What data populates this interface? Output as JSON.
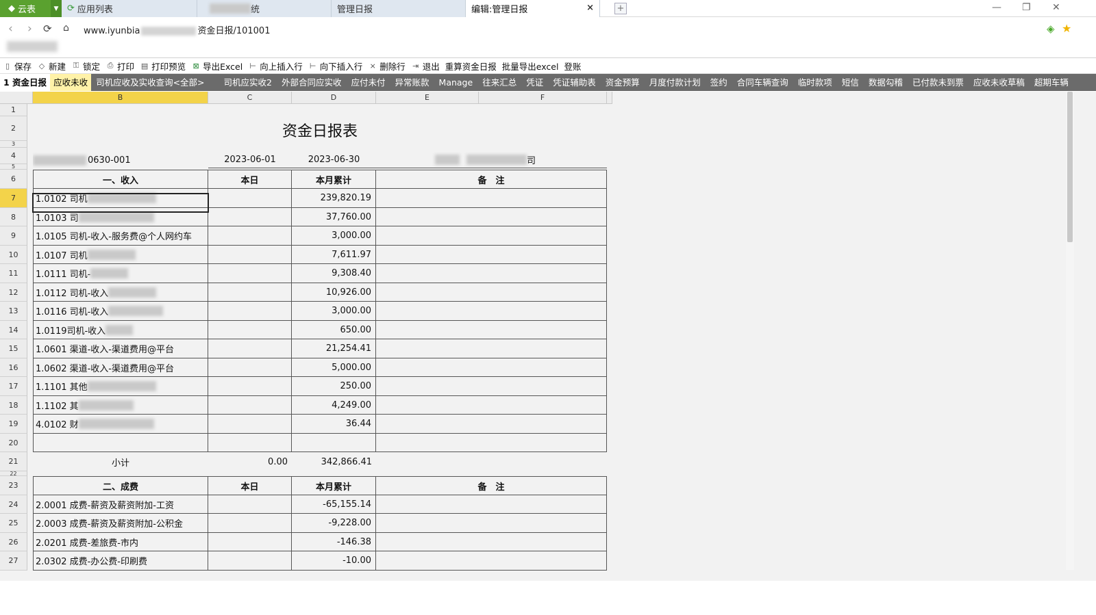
{
  "browser": {
    "logo_label": "云表",
    "tabs": [
      {
        "label": "应用列表",
        "active": false
      },
      {
        "label": "统",
        "active": false
      },
      {
        "label": "管理日报",
        "active": false
      },
      {
        "label": "编辑:管理日报",
        "active": true
      }
    ],
    "close_glyph": "×",
    "newtab_glyph": "+",
    "url_prefix": "www.iyunbia",
    "url_suffix": "资金日报/101001"
  },
  "toolbar": {
    "items": [
      {
        "label": "保存",
        "icon": "save-icon"
      },
      {
        "label": "新建",
        "icon": "new-icon"
      },
      {
        "label": "锁定",
        "icon": "lock-icon"
      },
      {
        "label": "打印",
        "icon": "print-icon"
      },
      {
        "label": "打印预览",
        "icon": "print-preview-icon"
      },
      {
        "label": "导出Excel",
        "icon": "excel-icon"
      },
      {
        "label": "向上插入行",
        "icon": "insert-above-icon"
      },
      {
        "label": "向下插入行",
        "icon": "insert-below-icon"
      },
      {
        "label": "删除行",
        "icon": "delete-row-icon"
      },
      {
        "label": "退出",
        "icon": "exit-icon"
      },
      {
        "label": "重算资金日报",
        "icon": ""
      },
      {
        "label": "批量导出excel",
        "icon": ""
      },
      {
        "label": "登账",
        "icon": ""
      }
    ]
  },
  "sheet_tabs": [
    "1 资金日报",
    "应收未收",
    "司机应收及实收查询<全部>",
    "司机应实收2",
    "外部合同应实收",
    "应付未付",
    "异常账款",
    "Manage",
    "往来汇总",
    "凭证",
    "凭证辅助表",
    "资金预算",
    "月度付款计划",
    "签约",
    "合同车辆查询",
    "临时款项",
    "短信",
    "数据勾稽",
    "已付款未到票",
    "应收未收草稿",
    "超期车辆"
  ],
  "columns": [
    "B",
    "C",
    "D",
    "E",
    "F"
  ],
  "report": {
    "title": "资金日报表",
    "doc_no_suffix": "0630-001",
    "date_from": "2023-06-01",
    "date_to": "2023-06-30",
    "company_suffix": "司",
    "income": {
      "header": [
        "一、收入",
        "本日",
        "本月累计",
        "备　注"
      ],
      "rows": [
        {
          "row": "7",
          "label": "1.0102 司机",
          "blur": 100,
          "today": "",
          "month": "239,820.19"
        },
        {
          "row": "8",
          "label": "1.0103 司",
          "blur": 110,
          "today": "",
          "month": "37,760.00"
        },
        {
          "row": "9",
          "label": "1.0105 司机-收入-服务费@个人网约车",
          "blur": 0,
          "today": "",
          "month": "3,000.00"
        },
        {
          "row": "10",
          "label": "1.0107 司机",
          "blur": 70,
          "today": "",
          "month": "7,611.97"
        },
        {
          "row": "11",
          "label": "1.0111 司机-",
          "blur": 55,
          "today": "",
          "month": "9,308.40"
        },
        {
          "row": "12",
          "label": "1.0112 司机-收入",
          "blur": 70,
          "today": "",
          "month": "10,926.00"
        },
        {
          "row": "13",
          "label": "1.0116 司机-收入",
          "blur": 80,
          "today": "",
          "month": "3,000.00"
        },
        {
          "row": "14",
          "label": "1.0119司机-收入",
          "blur": 40,
          "today": "",
          "month": "650.00"
        },
        {
          "row": "15",
          "label": "1.0601 渠道-收入-渠道费用@平台",
          "blur": 0,
          "today": "",
          "month": "21,254.41"
        },
        {
          "row": "16",
          "label": "1.0602 渠道-收入-渠道费用@平台",
          "blur": 0,
          "today": "",
          "month": "5,000.00"
        },
        {
          "row": "17",
          "label": "1.1101 其他",
          "blur": 100,
          "today": "",
          "month": "250.00"
        },
        {
          "row": "18",
          "label": "1.1102 其",
          "blur": 80,
          "today": "",
          "month": "4,249.00"
        },
        {
          "row": "19",
          "label": "4.0102 财",
          "blur": 110,
          "today": "",
          "month": "36.44"
        },
        {
          "row": "20",
          "label": "",
          "blur": 0,
          "today": "",
          "month": ""
        }
      ],
      "subtotal_label": "小计",
      "subtotal_today": "0.00",
      "subtotal_month": "342,866.41"
    },
    "cost": {
      "header": [
        "二、成费",
        "本日",
        "本月累计",
        "备　注"
      ],
      "rows": [
        {
          "row": "24",
          "label": "2.0001 成费-薪资及薪资附加-工资",
          "month": "-65,155.14"
        },
        {
          "row": "25",
          "label": "2.0003 成费-薪资及薪资附加-公积金",
          "month": "-9,228.00"
        },
        {
          "row": "26",
          "label": "2.0201 成费-差旅费-市内",
          "month": "-146.38"
        },
        {
          "row": "27",
          "label": "2.0302 成费-办公费-印刷费",
          "month": "-10.00"
        }
      ]
    }
  }
}
